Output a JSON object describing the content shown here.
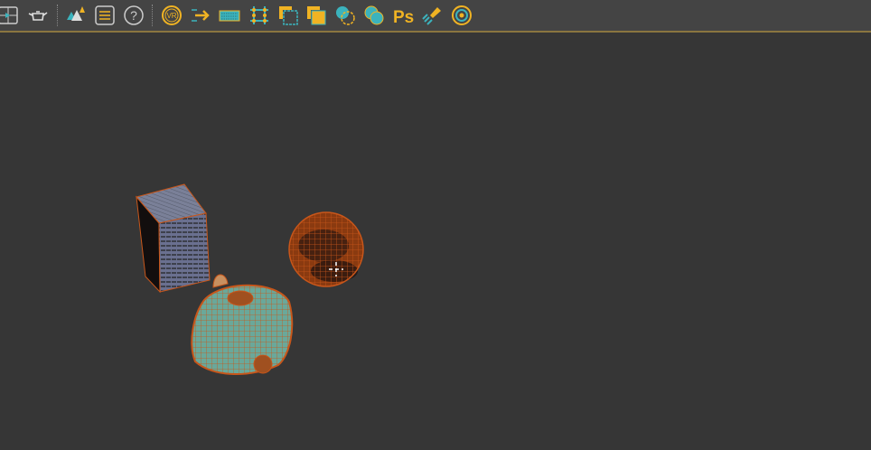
{
  "toolbar": {
    "items": [
      {
        "name": "viewport-layout",
        "icon": "viewport-layout-icon"
      },
      {
        "name": "teapot",
        "icon": "teapot-icon"
      },
      {
        "name": "scatter-trees",
        "icon": "trees-icon"
      },
      {
        "name": "list",
        "icon": "list-icon"
      },
      {
        "name": "help",
        "icon": "help-icon"
      },
      {
        "name": "vr",
        "icon": "vr-icon",
        "label": "VR"
      },
      {
        "name": "arrows",
        "icon": "arrows-icon"
      },
      {
        "name": "keyboard",
        "icon": "keyboard-icon"
      },
      {
        "name": "grid",
        "icon": "grid-icon"
      },
      {
        "name": "region-outline",
        "icon": "region-outline-icon"
      },
      {
        "name": "region-filled",
        "icon": "region-filled-icon"
      },
      {
        "name": "spheres-outline",
        "icon": "spheres-outline-icon"
      },
      {
        "name": "spheres-filled",
        "icon": "spheres-filled-icon"
      },
      {
        "name": "photoshop",
        "icon": "photoshop-icon",
        "label": "Ps"
      },
      {
        "name": "lamp",
        "icon": "lamp-icon"
      },
      {
        "name": "target",
        "icon": "target-icon"
      }
    ]
  },
  "colors": {
    "accent": "#f0b323",
    "teal": "#3bb3bd",
    "toolbar_bg": "#444444",
    "viewport_bg": "#363636",
    "wire": "#c8561a"
  }
}
